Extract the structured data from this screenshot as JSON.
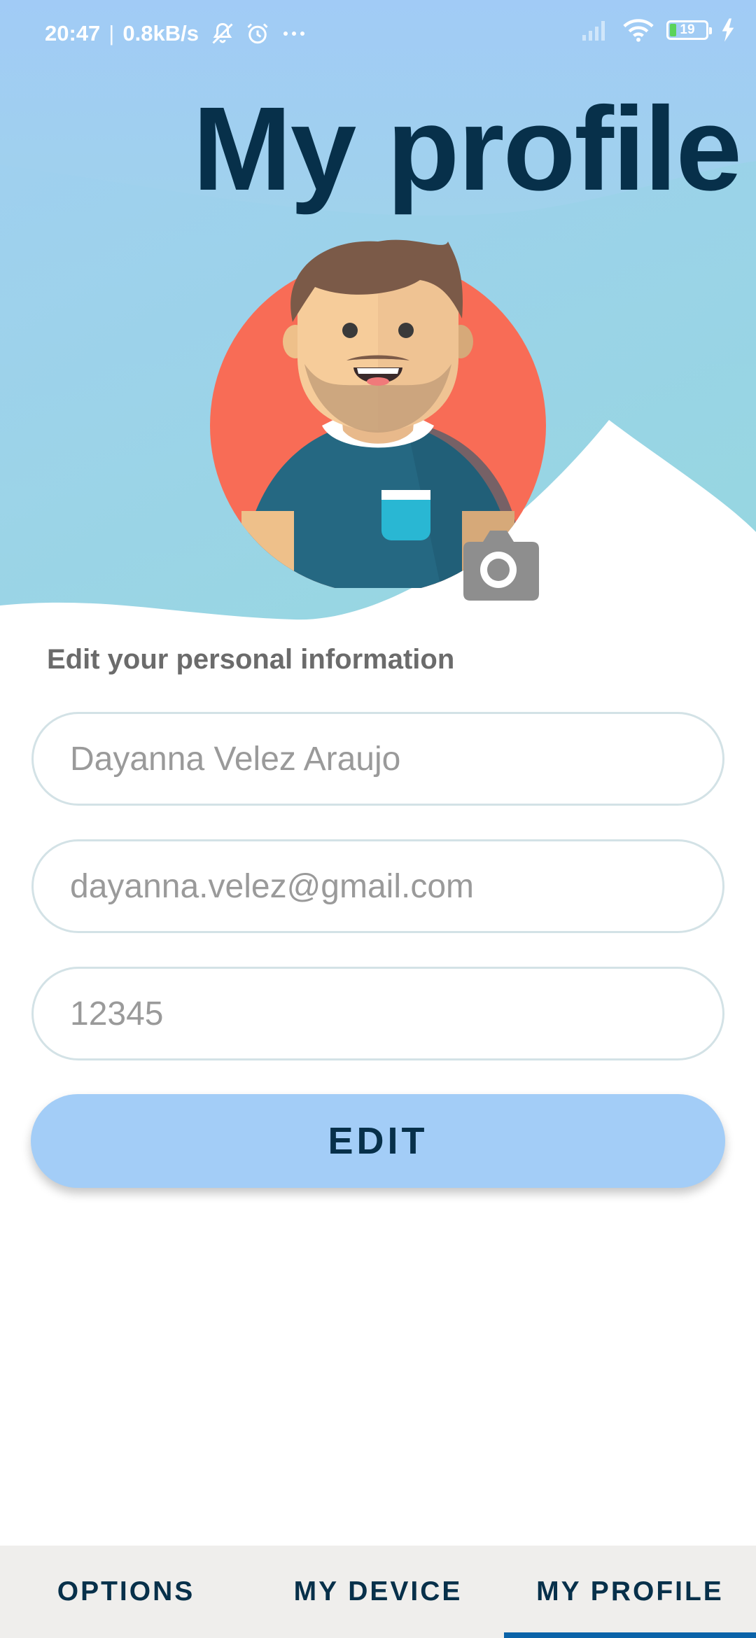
{
  "status_bar": {
    "time": "20:47",
    "separator": "|",
    "speed": "0.8kB/s",
    "icons_left": [
      "bell-off-icon",
      "alarm-icon",
      "more-icon"
    ],
    "icons_right": [
      "signal-icon",
      "wifi-icon",
      "battery-icon",
      "charging-icon"
    ],
    "battery_level": "19"
  },
  "header": {
    "title": "My profile",
    "avatar_icon": "user-avatar",
    "camera_icon": "camera-icon"
  },
  "form": {
    "section_label": "Edit your personal information",
    "name_value": "Dayanna Velez Araujo",
    "email_value": "dayanna.velez@gmail.com",
    "password_value": "12345",
    "edit_label": "EDIT"
  },
  "bottom_nav": {
    "tabs": [
      {
        "label": "OPTIONS",
        "active": false
      },
      {
        "label": "MY DEVICE",
        "active": false
      },
      {
        "label": "MY PROFILE",
        "active": true
      }
    ]
  },
  "colors": {
    "header_top": "#a1cbf6",
    "header_bottom": "#9edbd9",
    "title": "#07304a",
    "button": "#a3cdf7",
    "avatar_circle": "#f86c56",
    "nav_indicator": "#0b63a8"
  }
}
